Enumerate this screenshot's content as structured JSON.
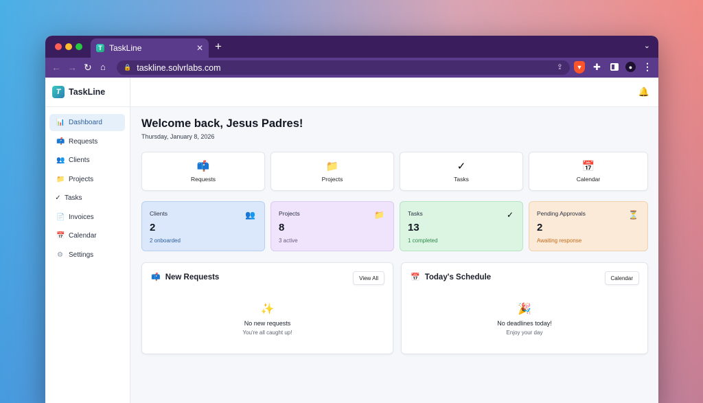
{
  "browser": {
    "tab_title": "TaskLine",
    "url": "taskline.solvrlabs.com",
    "new_tab": "+",
    "close": "✕"
  },
  "sidebar": {
    "brand": "TaskLine",
    "items": [
      {
        "label": "Dashboard",
        "icon": "chart-icon",
        "glyph": "📊",
        "active": true
      },
      {
        "label": "Requests",
        "icon": "mailbox-icon",
        "glyph": "📫"
      },
      {
        "label": "Clients",
        "icon": "users-icon",
        "glyph": "👥"
      },
      {
        "label": "Projects",
        "icon": "folder-icon",
        "glyph": "📁"
      },
      {
        "label": "Tasks",
        "icon": "check-icon",
        "glyph": "✓"
      },
      {
        "label": "Invoices",
        "icon": "document-icon",
        "glyph": "📄"
      },
      {
        "label": "Calendar",
        "icon": "calendar-icon",
        "glyph": "📅"
      },
      {
        "label": "Settings",
        "icon": "gear-icon",
        "glyph": "⚙"
      }
    ]
  },
  "header": {
    "welcome": "Welcome back, Jesus Padres!",
    "date": "Thursday, January 8, 2026"
  },
  "quick_actions": [
    {
      "label": "Requests",
      "icon": "mailbox-icon",
      "glyph": "📫"
    },
    {
      "label": "Projects",
      "icon": "folder-icon",
      "glyph": "📁"
    },
    {
      "label": "Tasks",
      "icon": "check-icon",
      "glyph": "✓"
    },
    {
      "label": "Calendar",
      "icon": "calendar-icon",
      "glyph": "📅"
    }
  ],
  "stats": [
    {
      "title": "Clients",
      "value": "2",
      "sub": "2 onboarded",
      "icon": "users-icon",
      "glyph": "👥",
      "color": "#dbe8fb"
    },
    {
      "title": "Projects",
      "value": "8",
      "sub": "3 active",
      "icon": "folder-icon",
      "glyph": "📁",
      "color": "#efe4fb"
    },
    {
      "title": "Tasks",
      "value": "13",
      "sub": "1 completed",
      "icon": "check-icon",
      "glyph": "✓",
      "color": "#dbf5e2"
    },
    {
      "title": "Pending Approvals",
      "value": "2",
      "sub": "Awaiting response",
      "icon": "hourglass-icon",
      "glyph": "⏳",
      "color": "#fbead7"
    }
  ],
  "panels": {
    "requests": {
      "title": "New Requests",
      "button": "View All",
      "empty_title": "No new requests",
      "empty_sub": "You're all caught up!",
      "icon": "mailbox-icon",
      "glyph": "📫",
      "emoji": "✨"
    },
    "schedule": {
      "title": "Today's Schedule",
      "button": "Calendar",
      "empty_title": "No deadlines today!",
      "empty_sub": "Enjoy your day",
      "icon": "calendar-icon",
      "glyph": "📅",
      "emoji": "🎉"
    }
  }
}
